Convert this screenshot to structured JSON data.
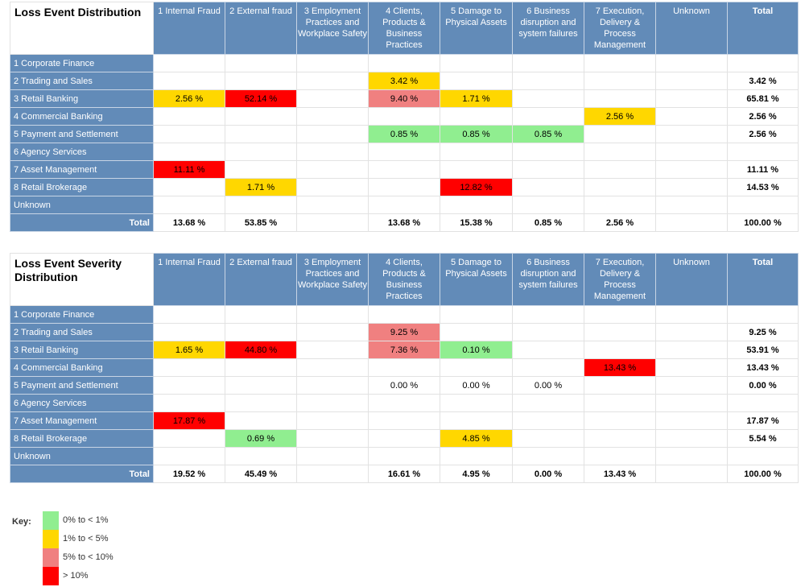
{
  "colors": {
    "header_bg": "#628bb8",
    "green": "#90ee90",
    "yellow": "#ffd700",
    "pink": "#f08080",
    "red": "#ff0000"
  },
  "columns": [
    "1 Internal Fraud",
    "2 External fraud",
    "3 Employment Practices and Workplace Safety",
    "4 Clients, Products & Business Practices",
    "5 Damage to Physical Assets",
    "6 Business disruption and system failures",
    "7 Execution, Delivery & Process Management",
    "Unknown",
    "Total"
  ],
  "rows": [
    "1 Corporate Finance",
    "2 Trading and Sales",
    "3 Retail Banking",
    "4 Commercial Banking",
    "5 Payment and Settlement",
    "6 Agency Services",
    "7 Asset Management",
    "8 Retail Brokerage",
    "Unknown",
    "Total"
  ],
  "tables": [
    {
      "title": "Loss Event Distribution",
      "cells": [
        [
          [
            "",
            ""
          ],
          [
            "",
            ""
          ],
          [
            "",
            ""
          ],
          [
            "",
            ""
          ],
          [
            "",
            ""
          ],
          [
            "",
            ""
          ],
          [
            "",
            ""
          ],
          [
            "",
            ""
          ],
          [
            "",
            ""
          ]
        ],
        [
          [
            "",
            ""
          ],
          [
            "",
            ""
          ],
          [
            "",
            ""
          ],
          [
            "3.42 %",
            "yellow"
          ],
          [
            "",
            ""
          ],
          [
            "",
            ""
          ],
          [
            "",
            ""
          ],
          [
            "",
            ""
          ],
          [
            "3.42 %",
            ""
          ]
        ],
        [
          [
            "2.56 %",
            "yellow"
          ],
          [
            "52.14 %",
            "red"
          ],
          [
            "",
            ""
          ],
          [
            "9.40 %",
            "pink"
          ],
          [
            "1.71 %",
            "yellow"
          ],
          [
            "",
            ""
          ],
          [
            "",
            ""
          ],
          [
            "",
            ""
          ],
          [
            "65.81 %",
            ""
          ]
        ],
        [
          [
            "",
            ""
          ],
          [
            "",
            ""
          ],
          [
            "",
            ""
          ],
          [
            "",
            ""
          ],
          [
            "",
            ""
          ],
          [
            "",
            ""
          ],
          [
            "2.56 %",
            "yellow"
          ],
          [
            "",
            ""
          ],
          [
            "2.56 %",
            ""
          ]
        ],
        [
          [
            "",
            ""
          ],
          [
            "",
            ""
          ],
          [
            "",
            ""
          ],
          [
            "0.85 %",
            "green"
          ],
          [
            "0.85 %",
            "green"
          ],
          [
            "0.85 %",
            "green"
          ],
          [
            "",
            ""
          ],
          [
            "",
            ""
          ],
          [
            "2.56 %",
            ""
          ]
        ],
        [
          [
            "",
            ""
          ],
          [
            "",
            ""
          ],
          [
            "",
            ""
          ],
          [
            "",
            ""
          ],
          [
            "",
            ""
          ],
          [
            "",
            ""
          ],
          [
            "",
            ""
          ],
          [
            "",
            ""
          ],
          [
            "",
            ""
          ]
        ],
        [
          [
            "11.11 %",
            "red"
          ],
          [
            "",
            ""
          ],
          [
            "",
            ""
          ],
          [
            "",
            ""
          ],
          [
            "",
            ""
          ],
          [
            "",
            ""
          ],
          [
            "",
            ""
          ],
          [
            "",
            ""
          ],
          [
            "11.11 %",
            ""
          ]
        ],
        [
          [
            "",
            ""
          ],
          [
            "1.71 %",
            "yellow"
          ],
          [
            "",
            ""
          ],
          [
            "",
            ""
          ],
          [
            "12.82 %",
            "red"
          ],
          [
            "",
            ""
          ],
          [
            "",
            ""
          ],
          [
            "",
            ""
          ],
          [
            "14.53 %",
            ""
          ]
        ],
        [
          [
            "",
            ""
          ],
          [
            "",
            ""
          ],
          [
            "",
            ""
          ],
          [
            "",
            ""
          ],
          [
            "",
            ""
          ],
          [
            "",
            ""
          ],
          [
            "",
            ""
          ],
          [
            "",
            ""
          ],
          [
            "",
            ""
          ]
        ],
        [
          [
            "13.68 %",
            ""
          ],
          [
            "53.85 %",
            ""
          ],
          [
            "",
            ""
          ],
          [
            "13.68 %",
            ""
          ],
          [
            "15.38 %",
            ""
          ],
          [
            "0.85 %",
            ""
          ],
          [
            "2.56 %",
            ""
          ],
          [
            "",
            ""
          ],
          [
            "100.00 %",
            ""
          ]
        ]
      ]
    },
    {
      "title": "Loss Event Severity Distribution",
      "cells": [
        [
          [
            "",
            ""
          ],
          [
            "",
            ""
          ],
          [
            "",
            ""
          ],
          [
            "",
            ""
          ],
          [
            "",
            ""
          ],
          [
            "",
            ""
          ],
          [
            "",
            ""
          ],
          [
            "",
            ""
          ],
          [
            "",
            ""
          ]
        ],
        [
          [
            "",
            ""
          ],
          [
            "",
            ""
          ],
          [
            "",
            ""
          ],
          [
            "9.25 %",
            "pink"
          ],
          [
            "",
            ""
          ],
          [
            "",
            ""
          ],
          [
            "",
            ""
          ],
          [
            "",
            ""
          ],
          [
            "9.25 %",
            ""
          ]
        ],
        [
          [
            "1.65 %",
            "yellow"
          ],
          [
            "44.80 %",
            "red"
          ],
          [
            "",
            ""
          ],
          [
            "7.36 %",
            "pink"
          ],
          [
            "0.10 %",
            "green"
          ],
          [
            "",
            ""
          ],
          [
            "",
            ""
          ],
          [
            "",
            ""
          ],
          [
            "53.91 %",
            ""
          ]
        ],
        [
          [
            "",
            ""
          ],
          [
            "",
            ""
          ],
          [
            "",
            ""
          ],
          [
            "",
            ""
          ],
          [
            "",
            ""
          ],
          [
            "",
            ""
          ],
          [
            "13.43 %",
            "red"
          ],
          [
            "",
            ""
          ],
          [
            "13.43 %",
            ""
          ]
        ],
        [
          [
            "",
            ""
          ],
          [
            "",
            ""
          ],
          [
            "",
            ""
          ],
          [
            "0.00 %",
            ""
          ],
          [
            "0.00 %",
            ""
          ],
          [
            "0.00 %",
            ""
          ],
          [
            "",
            ""
          ],
          [
            "",
            ""
          ],
          [
            "0.00 %",
            ""
          ]
        ],
        [
          [
            "",
            ""
          ],
          [
            "",
            ""
          ],
          [
            "",
            ""
          ],
          [
            "",
            ""
          ],
          [
            "",
            ""
          ],
          [
            "",
            ""
          ],
          [
            "",
            ""
          ],
          [
            "",
            ""
          ],
          [
            "",
            ""
          ]
        ],
        [
          [
            "17.87 %",
            "red"
          ],
          [
            "",
            ""
          ],
          [
            "",
            ""
          ],
          [
            "",
            ""
          ],
          [
            "",
            ""
          ],
          [
            "",
            ""
          ],
          [
            "",
            ""
          ],
          [
            "",
            ""
          ],
          [
            "17.87 %",
            ""
          ]
        ],
        [
          [
            "",
            ""
          ],
          [
            "0.69 %",
            "green"
          ],
          [
            "",
            ""
          ],
          [
            "",
            ""
          ],
          [
            "4.85 %",
            "yellow"
          ],
          [
            "",
            ""
          ],
          [
            "",
            ""
          ],
          [
            "",
            ""
          ],
          [
            "5.54 %",
            ""
          ]
        ],
        [
          [
            "",
            ""
          ],
          [
            "",
            ""
          ],
          [
            "",
            ""
          ],
          [
            "",
            ""
          ],
          [
            "",
            ""
          ],
          [
            "",
            ""
          ],
          [
            "",
            ""
          ],
          [
            "",
            ""
          ],
          [
            "",
            ""
          ]
        ],
        [
          [
            "19.52 %",
            ""
          ],
          [
            "45.49 %",
            ""
          ],
          [
            "",
            ""
          ],
          [
            "16.61 %",
            ""
          ],
          [
            "4.95 %",
            ""
          ],
          [
            "0.00 %",
            ""
          ],
          [
            "13.43 %",
            ""
          ],
          [
            "",
            ""
          ],
          [
            "100.00 %",
            ""
          ]
        ]
      ]
    }
  ],
  "key": {
    "label": "Key:",
    "items": [
      {
        "label": "0% to < 1%",
        "color": "green"
      },
      {
        "label": "1% to < 5%",
        "color": "yellow"
      },
      {
        "label": "5% to < 10%",
        "color": "pink"
      },
      {
        "label": "> 10%",
        "color": "red"
      }
    ]
  }
}
